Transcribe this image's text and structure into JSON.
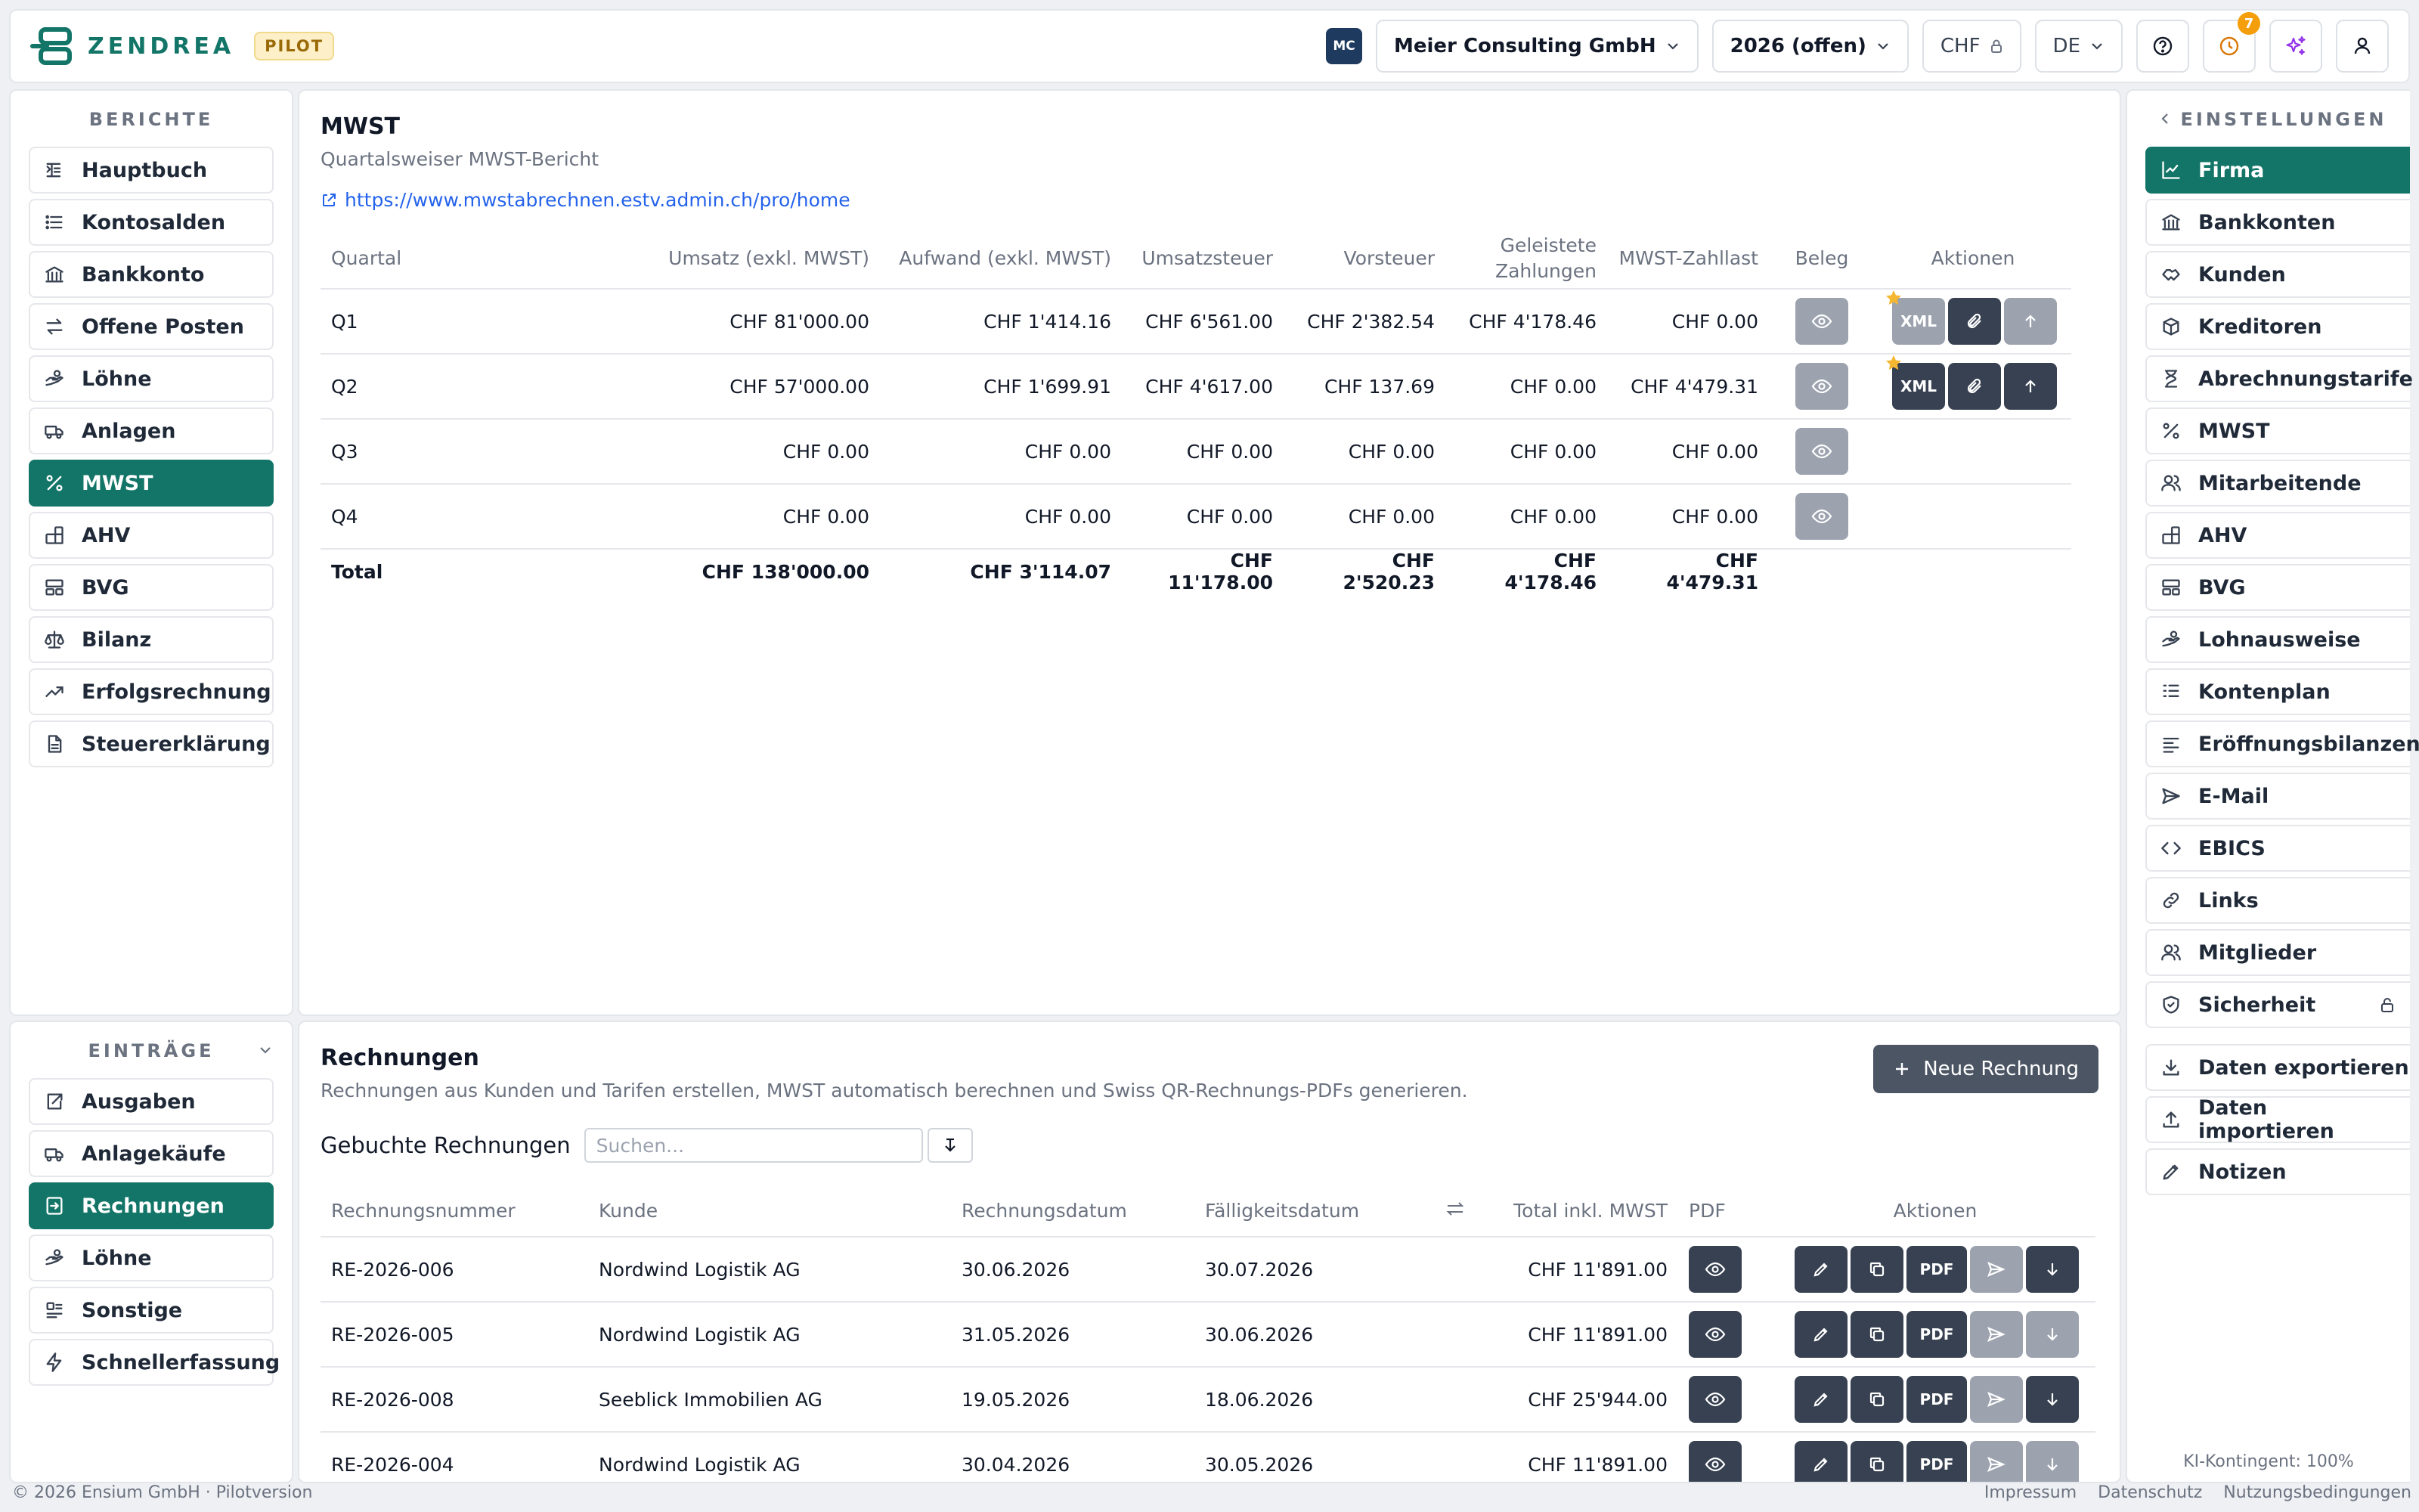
{
  "app": {
    "brand": "ZENDREA",
    "badge": "PILOT"
  },
  "topbar": {
    "company_initials": "MC",
    "company": "Meier Consulting GmbH",
    "year": "2026 (offen)",
    "currency": "CHF",
    "language": "DE",
    "notification_count": "7"
  },
  "left_nav": {
    "reports_title": "BERICHTE",
    "reports": [
      {
        "label": "Hauptbuch",
        "icon": "ledger-icon"
      },
      {
        "label": "Kontosalden",
        "icon": "list-icon"
      },
      {
        "label": "Bankkonto",
        "icon": "bank-icon"
      },
      {
        "label": "Offene Posten",
        "icon": "arrows-icon"
      },
      {
        "label": "Löhne",
        "icon": "hand-money-icon"
      },
      {
        "label": "Anlagen",
        "icon": "truck-icon"
      },
      {
        "label": "MWST",
        "icon": "percent-icon",
        "active": true
      },
      {
        "label": "AHV",
        "icon": "blocks-icon"
      },
      {
        "label": "BVG",
        "icon": "layout-icon"
      },
      {
        "label": "Bilanz",
        "icon": "scale-icon"
      },
      {
        "label": "Erfolgsrechnung",
        "icon": "trend-icon"
      },
      {
        "label": "Steuererklärung",
        "icon": "document-icon"
      }
    ],
    "entries_title": "EINTRÄGE",
    "entries": [
      {
        "label": "Ausgaben",
        "icon": "export-icon"
      },
      {
        "label": "Anlagekäufe",
        "icon": "truck-icon"
      },
      {
        "label": "Rechnungen",
        "icon": "invoice-icon",
        "active": true
      },
      {
        "label": "Löhne",
        "icon": "hand-money-icon"
      },
      {
        "label": "Sonstige",
        "icon": "misc-icon"
      },
      {
        "label": "Schnellerfassung",
        "icon": "bolt-icon"
      }
    ]
  },
  "right_nav": {
    "title": "EINSTELLUNGEN",
    "items": [
      {
        "label": "Firma",
        "icon": "chart-icon",
        "active": true
      },
      {
        "label": "Bankkonten",
        "icon": "bank-icon"
      },
      {
        "label": "Kunden",
        "icon": "handshake-icon"
      },
      {
        "label": "Kreditoren",
        "icon": "box-icon"
      },
      {
        "label": "Abrechnungstarife",
        "icon": "hourglass-icon"
      },
      {
        "label": "MWST",
        "icon": "percent-icon"
      },
      {
        "label": "Mitarbeitende",
        "icon": "users-icon"
      },
      {
        "label": "AHV",
        "icon": "blocks-icon"
      },
      {
        "label": "BVG",
        "icon": "layout-icon"
      },
      {
        "label": "Lohnausweise",
        "icon": "hand-money-icon"
      },
      {
        "label": "Kontenplan",
        "icon": "list-tree-icon"
      },
      {
        "label": "Eröffnungsbilanzen",
        "icon": "lines-icon"
      },
      {
        "label": "E-Mail",
        "icon": "send-icon"
      },
      {
        "label": "EBICS",
        "icon": "code-icon"
      },
      {
        "label": "Links",
        "icon": "link-icon"
      },
      {
        "label": "Mitglieder",
        "icon": "users-icon"
      },
      {
        "label": "Sicherheit",
        "icon": "shield-icon"
      }
    ],
    "extra": [
      {
        "label": "Daten exportieren",
        "icon": "download-icon"
      },
      {
        "label": "Daten importieren",
        "icon": "upload-icon"
      },
      {
        "label": "Notizen",
        "icon": "pen-icon"
      }
    ],
    "ki_quota": "KI-Kontingent: 100%"
  },
  "mwst": {
    "title": "MWST",
    "subtitle": "Quartalsweiser MWST-Bericht",
    "link": "https://www.mwstabrechnen.estv.admin.ch/pro/home",
    "columns": {
      "quartal": "Quartal",
      "umsatz": "Umsatz (exkl. MWST)",
      "aufwand": "Aufwand (exkl. MWST)",
      "umsatzsteuer": "Umsatzsteuer",
      "vorsteuer": "Vorsteuer",
      "geleistete_1": "Geleistete",
      "geleistete_2": "Zahlungen",
      "zahllast": "MWST-Zahllast",
      "beleg": "Beleg",
      "aktionen": "Aktionen"
    },
    "rows": [
      {
        "q": "Q1",
        "umsatz": "CHF 81'000.00",
        "aufwand": "CHF 1'414.16",
        "ust": "CHF 6'561.00",
        "vst": "CHF 2'382.54",
        "gel": "CHF 4'178.46",
        "zahl": "CHF 0.00"
      },
      {
        "q": "Q2",
        "umsatz": "CHF 57'000.00",
        "aufwand": "CHF 1'699.91",
        "ust": "CHF 4'617.00",
        "vst": "CHF 137.69",
        "gel": "CHF 0.00",
        "zahl": "CHF 4'479.31"
      },
      {
        "q": "Q3",
        "umsatz": "CHF 0.00",
        "aufwand": "CHF 0.00",
        "ust": "CHF 0.00",
        "vst": "CHF 0.00",
        "gel": "CHF 0.00",
        "zahl": "CHF 0.00"
      },
      {
        "q": "Q4",
        "umsatz": "CHF 0.00",
        "aufwand": "CHF 0.00",
        "ust": "CHF 0.00",
        "vst": "CHF 0.00",
        "gel": "CHF 0.00",
        "zahl": "CHF 0.00"
      }
    ],
    "total": {
      "label": "Total",
      "umsatz": "CHF 138'000.00",
      "aufwand": "CHF 3'114.07",
      "ust": "CHF 11'178.00",
      "vst": "CHF 2'520.23",
      "gel": "CHF 4'178.46",
      "zahl": "CHF 4'479.31"
    },
    "xml_label": "XML"
  },
  "invoices": {
    "title": "Rechnungen",
    "subtitle": "Rechnungen aus Kunden und Tarifen erstellen, MWST automatisch berechnen und Swiss QR-Rechnungs-PDFs generieren.",
    "new_button": "Neue Rechnung",
    "booked_label": "Gebuchte Rechnungen",
    "search_placeholder": "Suchen...",
    "columns": {
      "nummer": "Rechnungsnummer",
      "kunde": "Kunde",
      "datum": "Rechnungsdatum",
      "faellig": "Fälligkeitsdatum",
      "total": "Total inkl. MWST",
      "pdf": "PDF",
      "aktionen": "Aktionen"
    },
    "pdf_label": "PDF",
    "rows": [
      {
        "nr": "RE-2026-006",
        "kunde": "Nordwind Logistik AG",
        "datum": "30.06.2026",
        "faellig": "30.07.2026",
        "total": "CHF 11'891.00"
      },
      {
        "nr": "RE-2026-005",
        "kunde": "Nordwind Logistik AG",
        "datum": "31.05.2026",
        "faellig": "30.06.2026",
        "total": "CHF 11'891.00"
      },
      {
        "nr": "RE-2026-008",
        "kunde": "Seeblick Immobilien AG",
        "datum": "19.05.2026",
        "faellig": "18.06.2026",
        "total": "CHF 25'944.00"
      },
      {
        "nr": "RE-2026-004",
        "kunde": "Nordwind Logistik AG",
        "datum": "30.04.2026",
        "faellig": "30.05.2026",
        "total": "CHF 11'891.00"
      }
    ]
  },
  "footer": {
    "copyright": "© 2026 Ensium GmbH · Pilotversion",
    "links": [
      "Impressum",
      "Datenschutz",
      "Nutzungsbedingungen"
    ]
  }
}
